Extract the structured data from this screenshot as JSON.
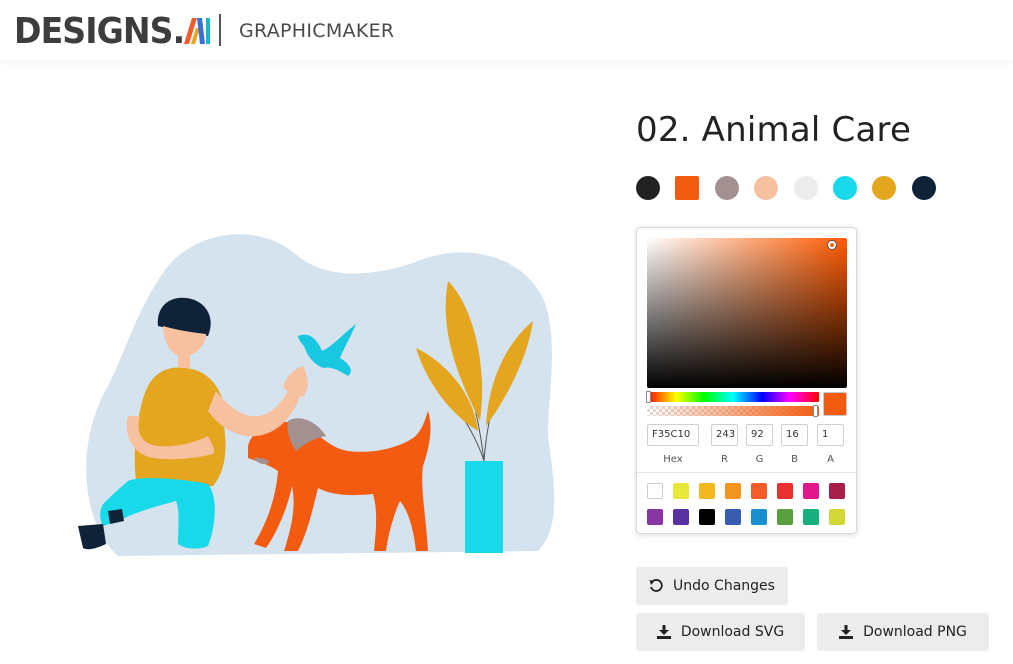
{
  "header": {
    "logo_text": "DESIGNS.",
    "logo_ai": "AI",
    "brand": "GRAPHICMAKER"
  },
  "design": {
    "title": "02. Animal Care"
  },
  "palette": {
    "swatches": [
      {
        "color": "#222222",
        "shape": "circle"
      },
      {
        "color": "#f35c10",
        "shape": "square"
      },
      {
        "color": "#a39090",
        "shape": "circle"
      },
      {
        "color": "#f7c09e",
        "shape": "circle"
      },
      {
        "color": "#ececec",
        "shape": "circle"
      },
      {
        "color": "#17d9ea",
        "shape": "circle"
      },
      {
        "color": "#e4a51f",
        "shape": "circle"
      },
      {
        "color": "#0e2238",
        "shape": "circle"
      }
    ]
  },
  "color_picker": {
    "hex": "F35C10",
    "r": "243",
    "g": "92",
    "b": "16",
    "a": "1",
    "labels": {
      "hex": "Hex",
      "r": "R",
      "g": "G",
      "b": "B",
      "a": "A"
    },
    "presets": [
      "#ffffff",
      "#e8e83a",
      "#f2b81d",
      "#f3961d",
      "#f35c2a",
      "#e83030",
      "#e0168a",
      "#a6204a",
      "#8a35a6",
      "#5a30a0",
      "#000000",
      "#3a5cb0",
      "#1a8ecf",
      "#5aa040",
      "#18b080",
      "#d0d838"
    ]
  },
  "actions": {
    "undo_label": "Undo Changes",
    "download_svg_label": "Download SVG",
    "download_png_label": "Download PNG"
  }
}
